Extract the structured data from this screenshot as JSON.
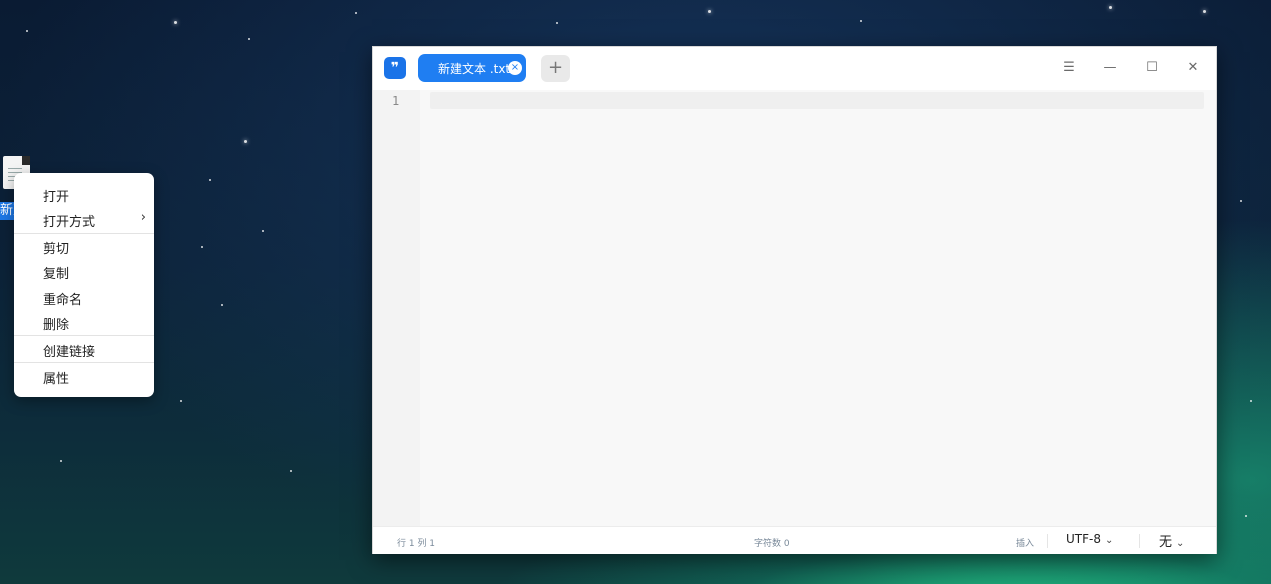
{
  "desktop": {
    "file_icon_name": "text-file-icon",
    "file_label": "新建文本"
  },
  "context_menu": {
    "items": [
      {
        "label": "打开"
      },
      {
        "label": "打开方式",
        "submenu": true
      },
      {
        "label": "剪切"
      },
      {
        "label": "复制"
      },
      {
        "label": "重命名"
      },
      {
        "label": "删除"
      },
      {
        "label": "创建链接"
      },
      {
        "label": "属性"
      }
    ],
    "submenu_arrow": "›"
  },
  "editor_window": {
    "tab": {
      "title": "新建文本  .txt",
      "close_glyph": "×"
    },
    "add_tab_glyph": "+",
    "controls": {
      "menu": "☰",
      "minimize": "—",
      "maximize": "☐",
      "close": "✕"
    },
    "line_number": "1",
    "status": {
      "position": "行 1  列 1",
      "char_count": "字符数 0",
      "mode": "插入",
      "encoding": "UTF-8",
      "highlight": "无"
    }
  },
  "colors": {
    "accent": "#1f7ef2",
    "menu_bg": "#ffffff"
  }
}
